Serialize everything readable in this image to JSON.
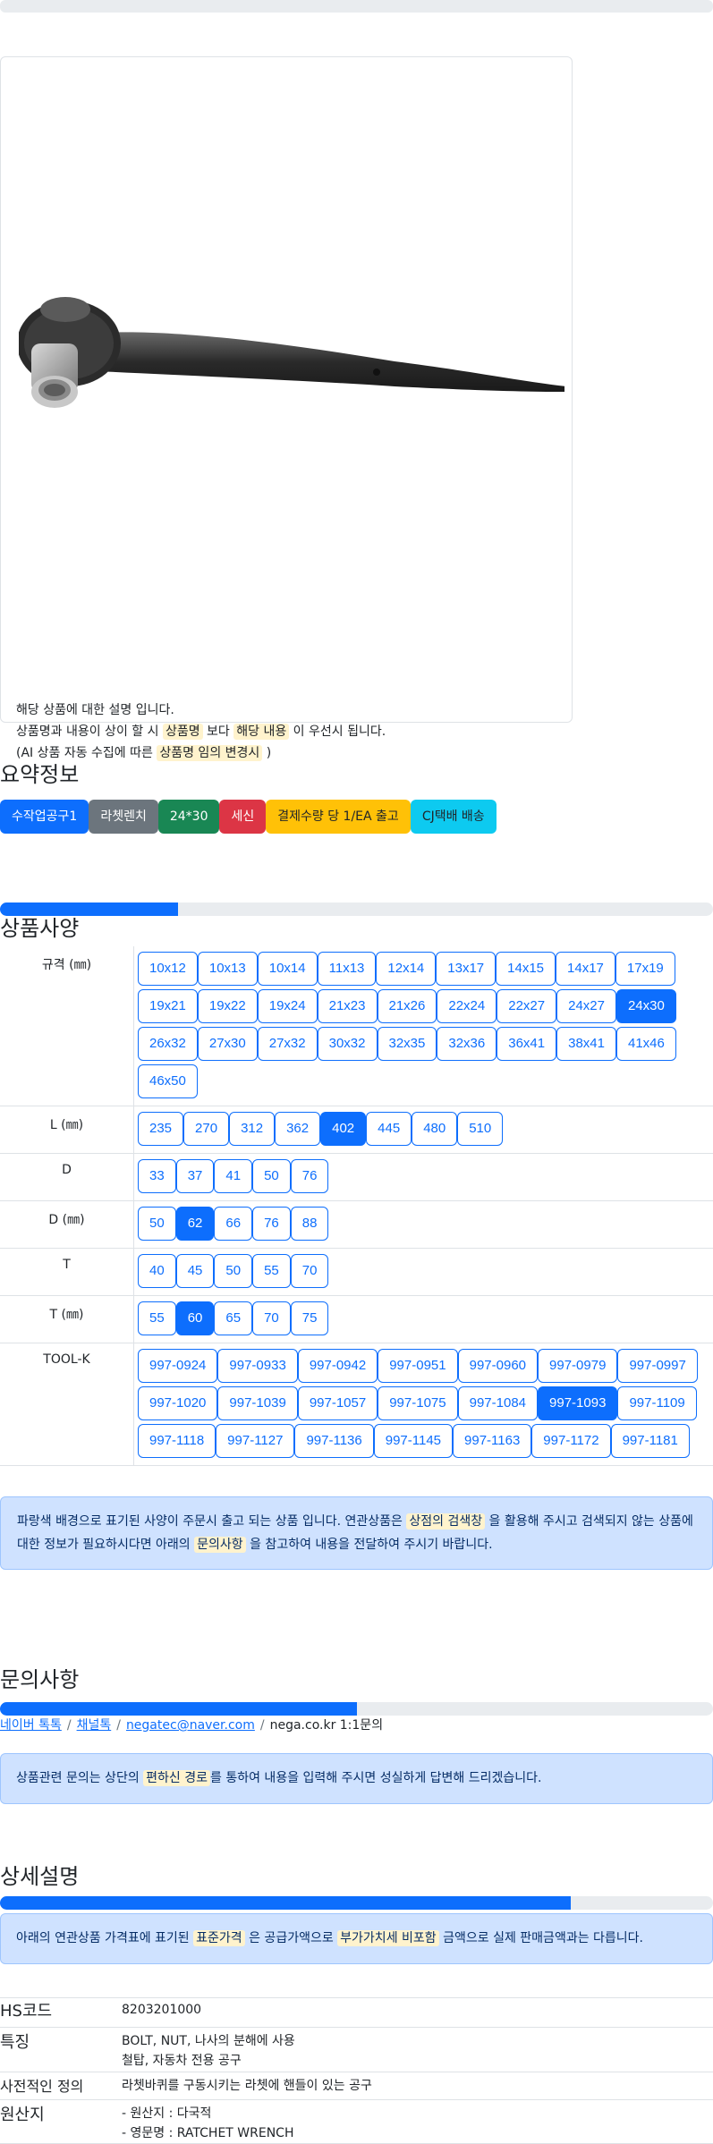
{
  "product": {
    "description_lines": [
      [
        "해당 상품에 대한 설명 입니다."
      ],
      [
        "상품명과 내용이 상이 할 시 ",
        {
          "hl": "상품명"
        },
        " 보다 ",
        {
          "hl": "해당 내용"
        },
        " 이 우선시 됩니다."
      ],
      [
        "(AI 상품 자동 수집에 따른 ",
        {
          "hl": "상품명 임의 변경시"
        },
        " )"
      ]
    ]
  },
  "summary": {
    "title": "요약정보",
    "badges": [
      {
        "label": "수작업공구1",
        "bg": "#0d6efd",
        "fg": "#ffffff"
      },
      {
        "label": "라쳇렌치",
        "bg": "#6c757d",
        "fg": "#ffffff"
      },
      {
        "label": "24*30",
        "bg": "#198754",
        "fg": "#ffffff"
      },
      {
        "label": "세신",
        "bg": "#dc3545",
        "fg": "#ffffff"
      },
      {
        "label": "결제수량 당 1/EA 출고",
        "bg": "#ffc107",
        "fg": "#212529"
      },
      {
        "label": "CJ택배 배송",
        "bg": "#0dcaf0",
        "fg": "#212529"
      }
    ]
  },
  "spec": {
    "title": "상품사양",
    "progress": 0.25,
    "rows": [
      {
        "label": "규격 (㎜)",
        "options": [
          "10x12",
          "10x13",
          "10x14",
          "11x13",
          "12x14",
          "13x17",
          "14x15",
          "14x17",
          "17x19",
          "19x21",
          "19x22",
          "19x24",
          "21x23",
          "21x26",
          "22x24",
          "22x27",
          "24x27",
          "24x30",
          "26x32",
          "27x30",
          "27x32",
          "30x32",
          "32x35",
          "32x36",
          "36x41",
          "38x41",
          "41x46",
          "46x50"
        ],
        "active": "24x30"
      },
      {
        "label": "L (㎜)",
        "options": [
          "235",
          "270",
          "312",
          "362",
          "402",
          "445",
          "480",
          "510"
        ],
        "active": "402"
      },
      {
        "label": "D",
        "options": [
          "33",
          "37",
          "41",
          "50",
          "76"
        ],
        "active": null
      },
      {
        "label": "D (㎜)",
        "options": [
          "50",
          "62",
          "66",
          "76",
          "88"
        ],
        "active": "62"
      },
      {
        "label": "T",
        "options": [
          "40",
          "45",
          "50",
          "55",
          "70"
        ],
        "active": null
      },
      {
        "label": "T (㎜)",
        "options": [
          "55",
          "60",
          "65",
          "70",
          "75"
        ],
        "active": "60"
      },
      {
        "label": "TOOL-K",
        "options": [
          "997-0924",
          "997-0933",
          "997-0942",
          "997-0951",
          "997-0960",
          "997-0979",
          "997-0997",
          "997-1020",
          "997-1039",
          "997-1057",
          "997-1075",
          "997-1084",
          "997-1093",
          "997-1109",
          "997-1118",
          "997-1127",
          "997-1136",
          "997-1145",
          "997-1163",
          "997-1172",
          "997-1181"
        ],
        "active": "997-1093"
      }
    ],
    "notice": [
      "파랑색 배경으로 표기된 사양이 주문시 출고 되는 상품 입니다. 연관상품은 ",
      {
        "hl": "상점의 검색창"
      },
      " 을 활용해 주시고 검색되지 않는 상품에 대한 정보가 필요하시다면 아래의 ",
      {
        "hl": "문의사항"
      },
      " 을 참고하여 내용을 전달하여 주시기 바랍니다."
    ]
  },
  "inquiry": {
    "title": "문의사항",
    "progress": 0.5,
    "links": [
      "네이버 톡톡",
      "채널톡",
      "negatec@naver.com"
    ],
    "plain": "nega.co.kr 1:1문의",
    "notice": [
      "상품관련 문의는 상단의 ",
      {
        "hl": "편하신 경로"
      },
      "를 통하여 내용을 입력해 주시면 성실하게 답변해 드리겠습니다."
    ]
  },
  "detail": {
    "title": "상세설명",
    "progress": 0.8,
    "notice": [
      "아래의 연관상품 가격표에 표기된 ",
      {
        "hl": "표준가격"
      },
      " 은 공급가액으로 ",
      {
        "hl": "부가가치세 비포함"
      },
      " 금액으로 실제 판매금액과는 다릅니다."
    ],
    "info": [
      {
        "key": "HS코드",
        "lines": [
          "8203201000"
        ]
      },
      {
        "key": "특징",
        "lines": [
          "BOLT, NUT, 나사의 분해에 사용",
          "철탑, 자동차 전용 공구"
        ]
      },
      {
        "key": "사전적인 정의",
        "lines": [
          "라쳇바퀴를 구동시키는 라쳇에 핸들이 있는 공구"
        ]
      },
      {
        "key": "원산지",
        "lines": [
          "- 원산지 : 다국적",
          "- 영문명 : RATCHET WRENCH"
        ]
      }
    ]
  }
}
